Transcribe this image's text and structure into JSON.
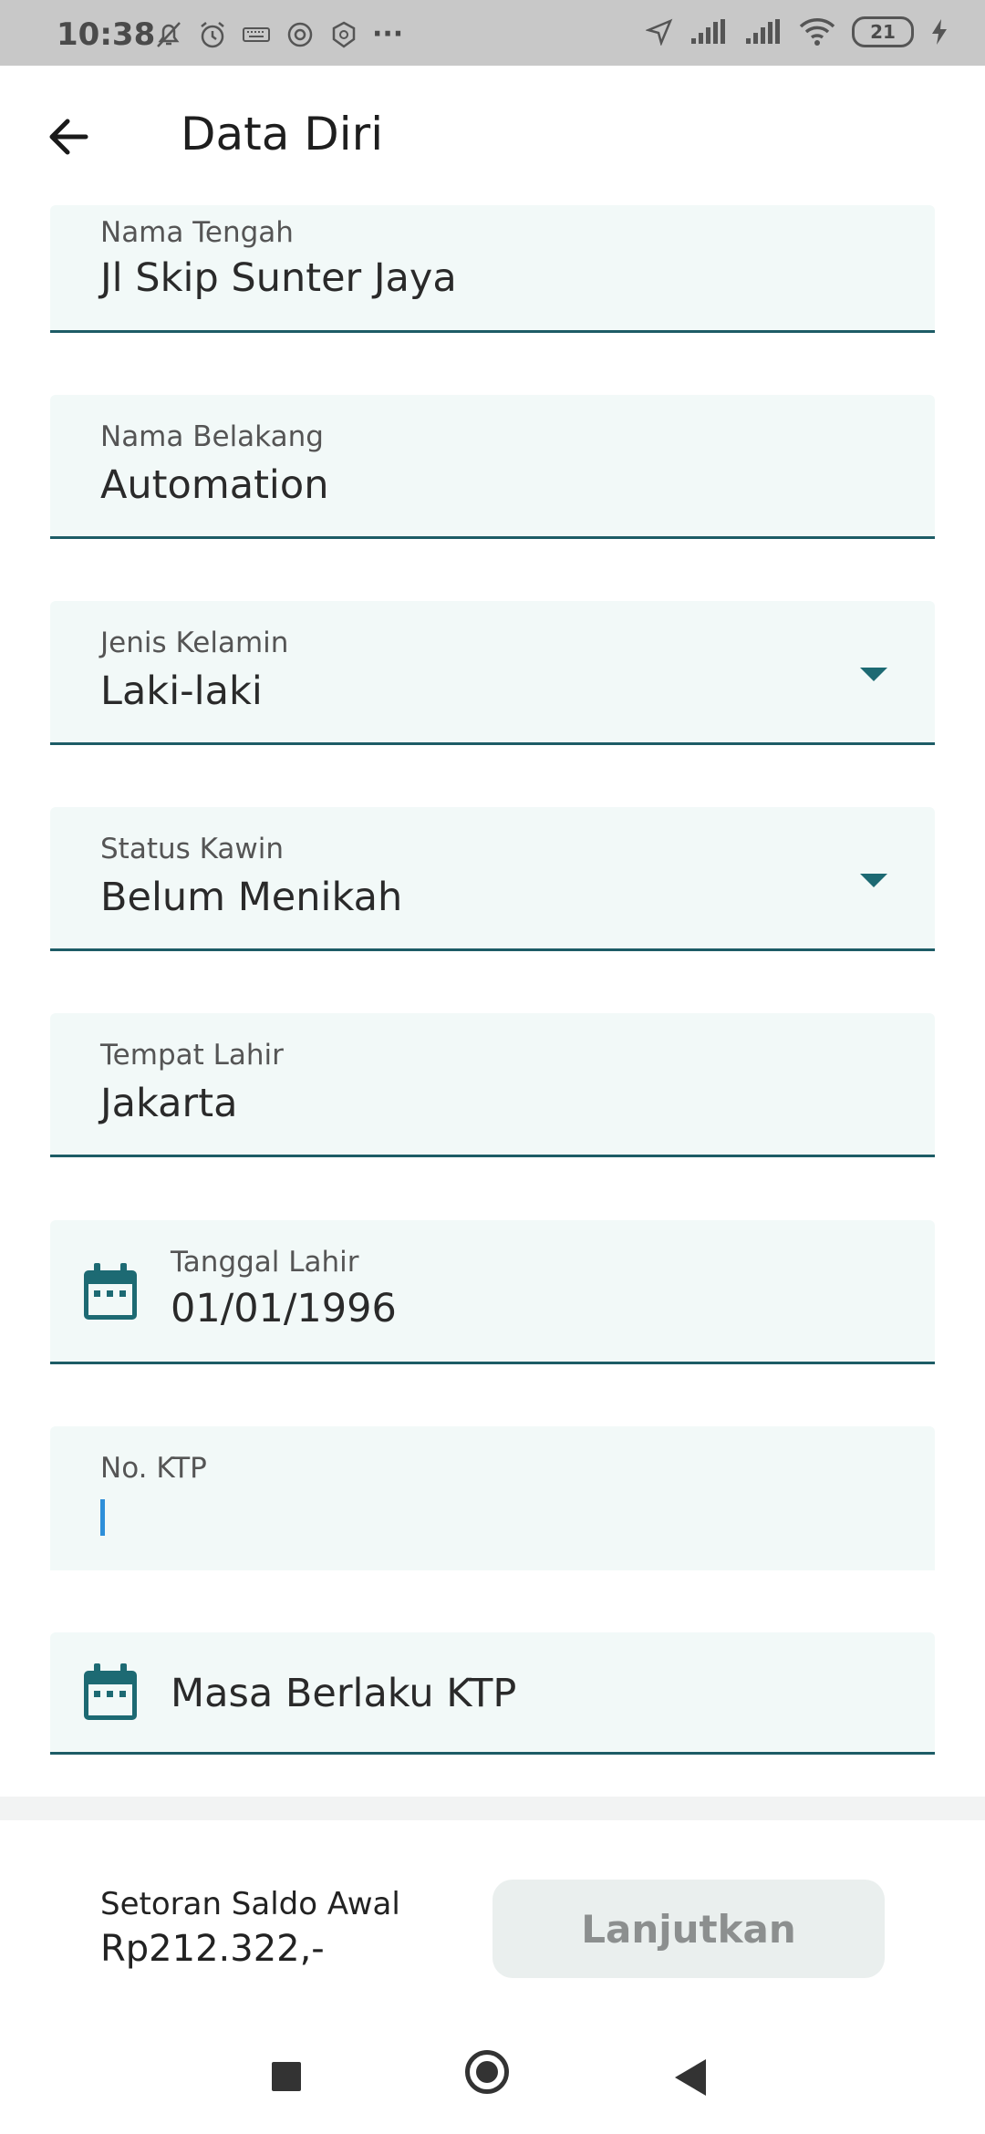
{
  "status_bar": {
    "time": "10:38",
    "more": "···",
    "battery": "21"
  },
  "header": {
    "title": "Data Diri",
    "back_icon": "arrow-left-icon"
  },
  "form": {
    "nama_tengah": {
      "label": "Nama Tengah",
      "value": "Jl Skip Sunter Jaya"
    },
    "nama_belakang": {
      "label": "Nama Belakang",
      "value": "Automation"
    },
    "jenis_kelamin": {
      "label": "Jenis Kelamin",
      "value": "Laki-laki"
    },
    "status_kawin": {
      "label": "Status Kawin",
      "value": "Belum Menikah"
    },
    "tempat_lahir": {
      "label": "Tempat Lahir",
      "value": "Jakarta"
    },
    "tanggal_lahir": {
      "label": "Tanggal Lahir",
      "value": "01/01/1996"
    },
    "no_ktp": {
      "label": "No. KTP",
      "value": ""
    },
    "masa_berlaku_ktp": {
      "placeholder": "Masa Berlaku KTP"
    }
  },
  "footer": {
    "deposit_label": "Setoran Saldo Awal",
    "deposit_value": "Rp212.322,-",
    "next_label": "Lanjutkan"
  },
  "colors": {
    "accent": "#1d5c66",
    "field_bg": "#f2f9f8",
    "button_disabled_bg": "#eaefee",
    "button_disabled_text": "#8c8f8f",
    "cursor": "#2e8fd9"
  }
}
